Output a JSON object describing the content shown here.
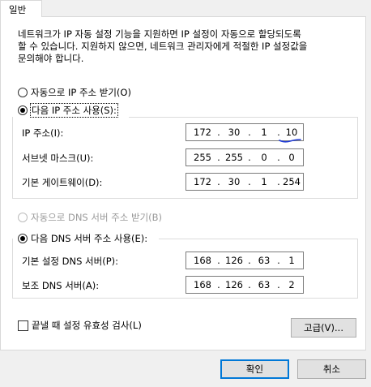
{
  "tab": {
    "label": "일반"
  },
  "description": "네트워크가 IP 자동 설정 기능을 지원하면 IP 설정이 자동으로 할당되도록\n할 수 있습니다. 지원하지 않으면, 네트워크 관리자에게 적절한 IP 설정값을\n문의해야 합니다.",
  "ip": {
    "auto_label": "자동으로 IP 주소 받기(O)",
    "manual_label": "다음 IP 주소 사용(S):",
    "selected": "manual",
    "fields": [
      {
        "label": "IP 주소(I):",
        "octets": [
          "172",
          "30",
          "1",
          "10"
        ]
      },
      {
        "label": "서브넷 마스크(U):",
        "octets": [
          "255",
          "255",
          "0",
          "0"
        ]
      },
      {
        "label": "기본 게이트웨이(D):",
        "octets": [
          "172",
          "30",
          "1",
          "254"
        ]
      }
    ]
  },
  "dns": {
    "auto_label": "자동으로 DNS 서버 주소 받기(B)",
    "manual_label": "다음 DNS 서버 주소 사용(E):",
    "selected": "manual",
    "fields": [
      {
        "label": "기본 설정 DNS 서버(P):",
        "octets": [
          "168",
          "126",
          "63",
          "1"
        ]
      },
      {
        "label": "보조 DNS 서버(A):",
        "octets": [
          "168",
          "126",
          "63",
          "2"
        ]
      }
    ]
  },
  "validate": {
    "label": "끝낼 때 설정 유효성 검사(L)",
    "checked": false
  },
  "buttons": {
    "advanced": "고급(V)...",
    "ok": "확인",
    "cancel": "취소"
  },
  "colors": {
    "accent": "#0078d7",
    "annotation": "#1f3bd6"
  }
}
